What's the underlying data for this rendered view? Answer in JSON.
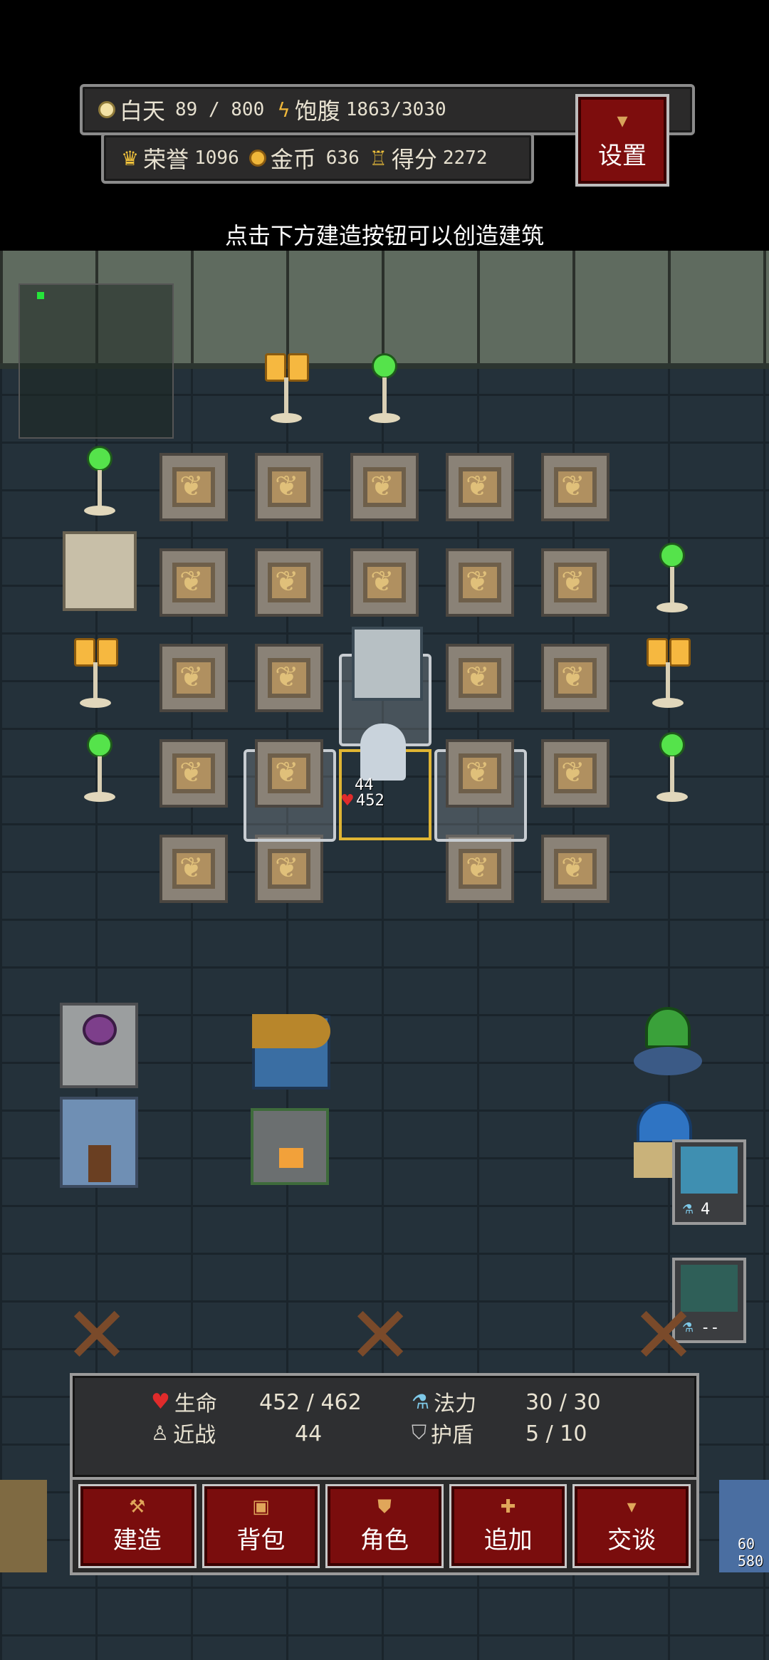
{
  "hud": {
    "day_label": "白天",
    "day_value": "89 / 800",
    "hunger_label": "饱腹",
    "hunger_value": "1863/3030",
    "honor_label": "荣誉",
    "honor_value": "1096",
    "gold_label": "金币",
    "gold_value": "636",
    "score_label": "得分",
    "score_value": "2272",
    "settings_label": "设置"
  },
  "hint": "点击下方建造按钮可以创造建筑",
  "hero": {
    "attack": "44",
    "hp": "452"
  },
  "skills": [
    {
      "count": "4"
    },
    {
      "count": "--"
    }
  ],
  "stats": {
    "hp_label": "生命",
    "hp_value": "452 / 462",
    "mana_label": "法力",
    "mana_value": "30 / 30",
    "melee_label": "近战",
    "melee_value": "44",
    "shield_label": "护盾",
    "shield_value": "5 / 10"
  },
  "actions": {
    "build": "建造",
    "bag": "背包",
    "character": "角色",
    "add": "追加",
    "talk": "交谈"
  },
  "edge_units": {
    "right_top": "60",
    "right_bottom": "580"
  }
}
